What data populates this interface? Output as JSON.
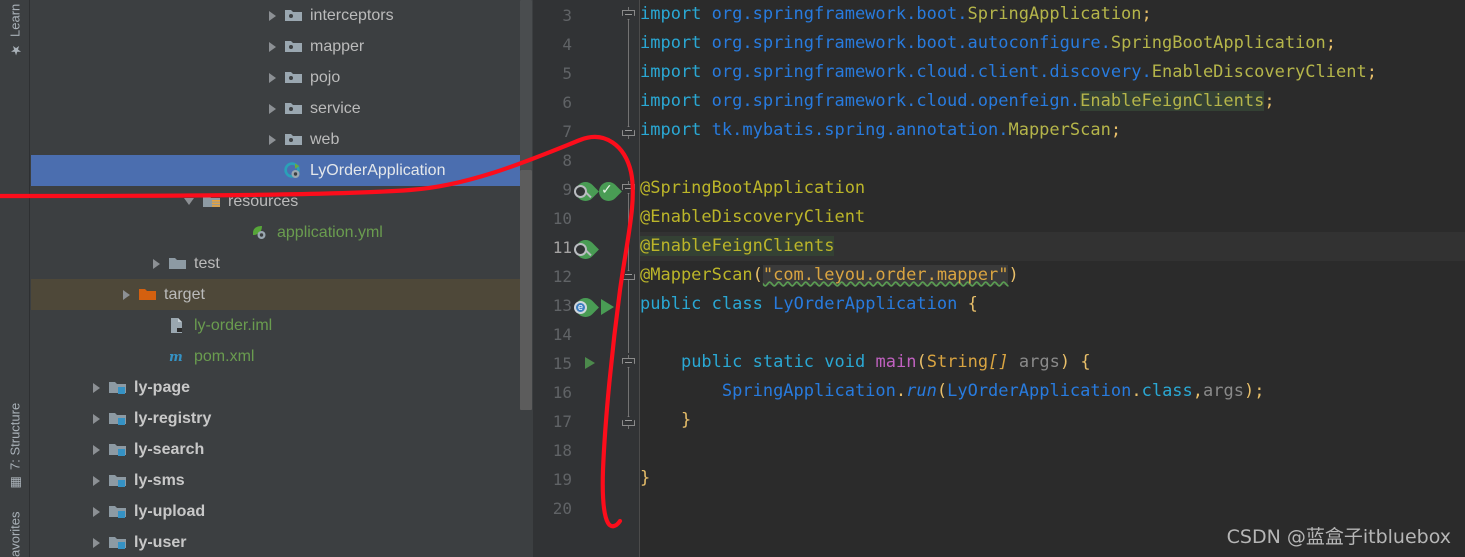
{
  "toolwindows": {
    "learn": {
      "label": "Learn",
      "icon": "graduation-cap-icon"
    },
    "structure": {
      "label": "7: Structure",
      "icon": "structure-icon"
    },
    "favorites": {
      "label": "avorites",
      "icon": "favorites-icon"
    }
  },
  "project_tree": {
    "rows": [
      {
        "name": "interceptors",
        "kind": "package",
        "arrow": "right",
        "indent": 238,
        "style": "plain"
      },
      {
        "name": "mapper",
        "kind": "package",
        "arrow": "right",
        "indent": 238,
        "style": "plain"
      },
      {
        "name": "pojo",
        "kind": "package",
        "arrow": "right",
        "indent": 238,
        "style": "plain"
      },
      {
        "name": "service",
        "kind": "package",
        "arrow": "right",
        "indent": 238,
        "style": "plain"
      },
      {
        "name": "web",
        "kind": "package",
        "arrow": "right",
        "indent": 238,
        "style": "plain"
      },
      {
        "name": "LyOrderApplication",
        "kind": "springboot-class",
        "arrow": "none",
        "indent": 238,
        "style": "selected"
      },
      {
        "name": "resources",
        "kind": "resources-folder",
        "arrow": "down",
        "indent": 153,
        "style": "plain"
      },
      {
        "name": "application.yml",
        "kind": "yaml-file",
        "arrow": "none",
        "indent": 205,
        "style": "green"
      },
      {
        "name": "test",
        "kind": "folder",
        "arrow": "right",
        "indent": 122,
        "style": "plain"
      },
      {
        "name": "target",
        "kind": "target-folder",
        "arrow": "right",
        "indent": 92,
        "style": "target"
      },
      {
        "name": "ly-order.iml",
        "kind": "iml-file",
        "arrow": "none",
        "indent": 122,
        "style": "green"
      },
      {
        "name": "pom.xml",
        "kind": "maven-file",
        "arrow": "none",
        "indent": 122,
        "style": "green"
      },
      {
        "name": "ly-page",
        "kind": "module",
        "arrow": "right",
        "indent": 62,
        "style": "bold"
      },
      {
        "name": "ly-registry",
        "kind": "module",
        "arrow": "right",
        "indent": 62,
        "style": "bold"
      },
      {
        "name": "ly-search",
        "kind": "module",
        "arrow": "right",
        "indent": 62,
        "style": "bold"
      },
      {
        "name": "ly-sms",
        "kind": "module",
        "arrow": "right",
        "indent": 62,
        "style": "bold"
      },
      {
        "name": "ly-upload",
        "kind": "module",
        "arrow": "right",
        "indent": 62,
        "style": "bold"
      },
      {
        "name": "ly-user",
        "kind": "module",
        "arrow": "right",
        "indent": 62,
        "style": "bold"
      }
    ]
  },
  "editor": {
    "line_numbers": [
      "3",
      "4",
      "5",
      "6",
      "7",
      "8",
      "9",
      "10",
      "11",
      "12",
      "13",
      "14",
      "15",
      "16",
      "17",
      "18",
      "19",
      "20"
    ],
    "current_line": "11",
    "lines": {
      "l3": {
        "kw": "import",
        "pkg": " org.springframework.boot.",
        "cls": "SpringApplication",
        "semi": ";"
      },
      "l4": {
        "kw": "import",
        "pkg": " org.springframework.boot.autoconfigure.",
        "cls": "SpringBootApplication",
        "semi": ";"
      },
      "l5": {
        "kw": "import",
        "pkg": " org.springframework.cloud.client.discovery.",
        "cls": "EnableDiscoveryClient",
        "semi": ";"
      },
      "l6": {
        "kw": "import",
        "pkg": " org.springframework.cloud.openfeign.",
        "cls": "EnableFeignClients",
        "semi": ";"
      },
      "l7": {
        "kw": "import",
        "pkg": " tk.mybatis.spring.annotation.",
        "cls": "MapperScan",
        "semi": ";"
      },
      "l9": {
        "anno": "@SpringBootApplication"
      },
      "l10": {
        "anno": "@EnableDiscoveryClient"
      },
      "l11": {
        "anno": "@EnableFeignClients"
      },
      "l12": {
        "anno": "@MapperScan",
        "open": "(",
        "str": "\"com.leyou.order.mapper\"",
        "close": ")"
      },
      "l13": {
        "kw1": "public",
        "kw2": "class",
        "name": "LyOrderApplication",
        "brace": "{"
      },
      "l15": {
        "kw1": "public",
        "kw2": "static",
        "kw3": "void",
        "meth": "main",
        "open": "(",
        "type": "String",
        "arr": "[]",
        "param": "args",
        "close": ")",
        "brace": "{"
      },
      "l16": {
        "cls": "SpringApplication",
        "dot1": ".",
        "meth": "run",
        "open": "(",
        "arg": "LyOrderApplication",
        "dot2": ".",
        "kw": "class",
        "comma": ",",
        "param": "args",
        "close": ")",
        "semi": ";"
      },
      "l17": {
        "brace": "}"
      },
      "l19": {
        "brace": "}"
      }
    },
    "gutter_icons": [
      {
        "line": "9",
        "icons": [
          "spring-bean-search-icon",
          "spring-bean-check-icon"
        ]
      },
      {
        "line": "11",
        "icons": [
          "spring-bean-search-icon"
        ]
      },
      {
        "line": "13",
        "icons": [
          "spring-bean-config-icon",
          "run-application-icon"
        ]
      },
      {
        "line": "15",
        "icons": [
          "run-method-icon"
        ]
      }
    ]
  },
  "watermark": {
    "text": "CSDN @蓝盒子itbluebox"
  },
  "annotation": {
    "color": "#fc0d1b",
    "shape": "hand-drawn-loop-pointer"
  },
  "colors": {
    "selection_blue": "#4b6eaf",
    "target_olive": "#4e4839",
    "editor_bg": "#2b2b2b",
    "panel_bg": "#3c3f41",
    "gutter_bg": "#313335",
    "keyword_cyan": "#2aa8d4",
    "package_blue": "#287bde",
    "class_olive": "#b5b54a",
    "annotation_yellow": "#bbb529",
    "string_orange": "#d9a441",
    "method_magenta": "#c061c0",
    "usage_highlight": "#344134"
  }
}
